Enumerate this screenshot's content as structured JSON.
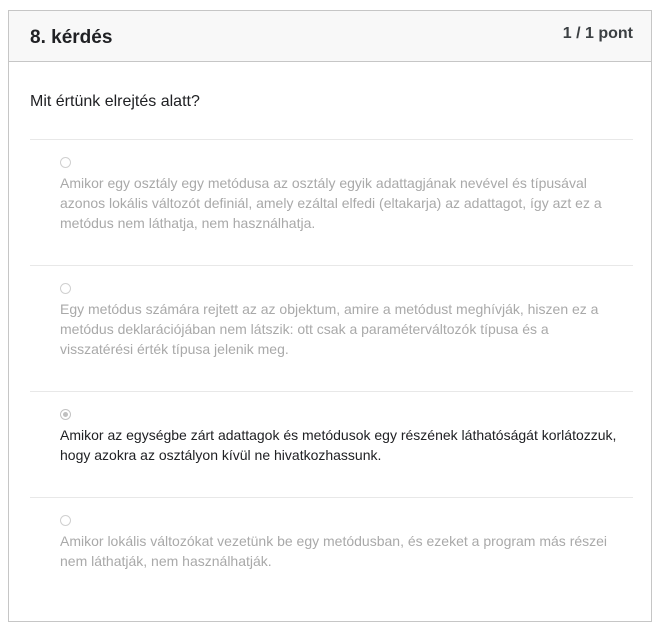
{
  "question": {
    "title": "8. kérdés",
    "score": "1 / 1 pont",
    "text": "Mit értünk elrejtés alatt?"
  },
  "options": [
    {
      "text": "Amikor egy osztály egy metódusa az osztály egyik adattagjának nevével és típusával azonos lokális változót definiál, amely ezáltal elfedi (eltakarja) az adattagot, így azt ez a metódus nem láthatja, nem használhatja.",
      "selected": false
    },
    {
      "text": "Egy metódus számára rejtett az az objektum, amire a metódust meghívják, hiszen ez a metódus deklarációjában nem látszik: ott csak a paraméterváltozók típusa és a visszatérési érték típusa jelenik meg.",
      "selected": false
    },
    {
      "text": "Amikor az egységbe zárt adattagok és metódusok egy részének láthatóságát korlátozzuk, hogy azokra az osztályon kívül ne hivatkozhassunk.",
      "selected": true
    },
    {
      "text": "Amikor lokális változókat vezetünk be egy metódusban, és ezeket a program más részei nem láthatják, nem használhatják.",
      "selected": false
    }
  ]
}
